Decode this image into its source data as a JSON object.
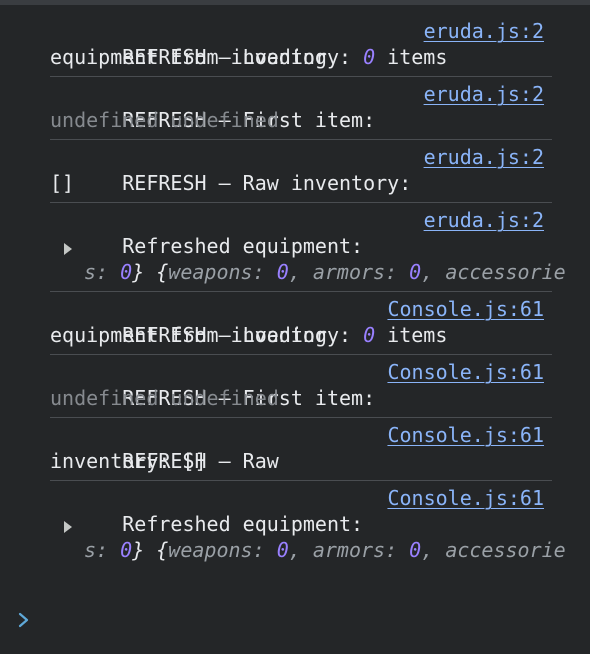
{
  "entries": [
    {
      "source": "eruda.js:2",
      "l1": "REFRESH – Loading",
      "l2": "equipment from inventory: ",
      "count": "0",
      "l2b": " items"
    },
    {
      "source": "eruda.js:2",
      "l1": "REFRESH – First item:",
      "l2": "undefined undefined"
    },
    {
      "source": "eruda.js:2",
      "l1": "REFRESH – Raw inventory:",
      "l2": "[]"
    },
    {
      "source": "eruda.js:2",
      "l1": "Refreshed equipment:",
      "obj": {
        "open": "{",
        "k1": "weapons",
        "v1": "0",
        "k2": "armors",
        "v2": "0",
        "k3a": "accessorie",
        "k3b": "s",
        "v3": "0",
        "close": "}"
      }
    },
    {
      "source": "Console.js:61",
      "l1": "REFRESH – Loading",
      "l2": "equipment from inventory: ",
      "count": "0",
      "l2b": " items"
    },
    {
      "source": "Console.js:61",
      "l1": "REFRESH – First item:",
      "l2": "undefined undefined"
    },
    {
      "source": "Console.js:61",
      "l1": "REFRESH – Raw",
      "l2": "inventory: []"
    },
    {
      "source": "Console.js:61",
      "l1": "Refreshed equipment:",
      "obj": {
        "open": "{",
        "k1": "weapons",
        "v1": "0",
        "k2": "armors",
        "v2": "0",
        "k3a": "accessorie",
        "k3b": "s",
        "v3": "0",
        "close": "}"
      }
    }
  ],
  "colors": {
    "background": "#242628",
    "link": "#8ab4f8",
    "number": "#9980ff",
    "muted": "#868a8f",
    "prompt": "#5fa8d8"
  },
  "prompt_icon": "chevron-right-icon"
}
